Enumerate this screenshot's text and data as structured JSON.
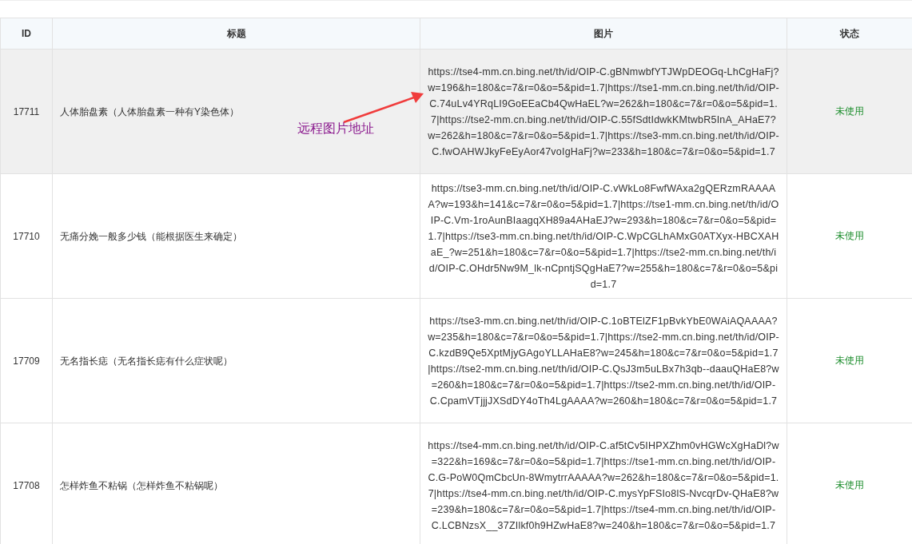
{
  "table": {
    "columns": [
      {
        "label": "ID"
      },
      {
        "label": "标题"
      },
      {
        "label": "图片"
      },
      {
        "label": "状态"
      }
    ],
    "rows": [
      {
        "id": "17711",
        "title": "人体胎盘素（人体胎盘素一种有Y染色体）",
        "image": "https://tse4-mm.cn.bing.net/th/id/OIP-C.gBNmwbfYTJWpDEOGq-LhCgHaFj?w=196&h=180&c=7&r=0&o=5&pid=1.7|https://tse1-mm.cn.bing.net/th/id/OIP-C.74uLv4YRqLI9GoEEaCb4QwHaEL?w=262&h=180&c=7&r=0&o=5&pid=1.7|https://tse2-mm.cn.bing.net/th/id/OIP-C.55fSdtIdwkKMtwbR5InA_AHaE7?w=262&h=180&c=7&r=0&o=5&pid=1.7|https://tse3-mm.cn.bing.net/th/id/OIP-C.fwOAHWJkyFeEyAor47voIgHaFj?w=233&h=180&c=7&r=0&o=5&pid=1.7",
        "status": "未使用",
        "highlighted": true
      },
      {
        "id": "17710",
        "title": "无痛分娩一般多少钱（能根据医生来确定）",
        "image": "https://tse3-mm.cn.bing.net/th/id/OIP-C.vWkLo8FwfWAxa2gQERzmRAAAAA?w=193&h=141&c=7&r=0&o=5&pid=1.7|https://tse1-mm.cn.bing.net/th/id/OIP-C.Vm-1roAunBIaagqXH89a4AHaEJ?w=293&h=180&c=7&r=0&o=5&pid=1.7|https://tse3-mm.cn.bing.net/th/id/OIP-C.WpCGLhAMxG0ATXyx-HBCXAHaE_?w=251&h=180&c=7&r=0&o=5&pid=1.7|https://tse2-mm.cn.bing.net/th/id/OIP-C.OHdr5Nw9M_lk-nCpntjSQgHaE7?w=255&h=180&c=7&r=0&o=5&pid=1.7",
        "status": "未使用",
        "highlighted": false
      },
      {
        "id": "17709",
        "title": "无名指长痣（无名指长痣有什么症状呢）",
        "image": "https://tse3-mm.cn.bing.net/th/id/OIP-C.1oBTElZF1pBvkYbE0WAiAQAAAA?w=235&h=180&c=7&r=0&o=5&pid=1.7|https://tse2-mm.cn.bing.net/th/id/OIP-C.kzdB9Qe5XptMjyGAgoYLLAHaE8?w=245&h=180&c=7&r=0&o=5&pid=1.7|https://tse2-mm.cn.bing.net/th/id/OIP-C.QsJ3m5uLBx7h3qb--daauQHaE8?w=260&h=180&c=7&r=0&o=5&pid=1.7|https://tse2-mm.cn.bing.net/th/id/OIP-C.CpamVTjjjJXSdDY4oTh4LgAAAA?w=260&h=180&c=7&r=0&o=5&pid=1.7",
        "status": "未使用",
        "highlighted": false
      },
      {
        "id": "17708",
        "title": "怎样炸鱼不粘锅（怎样炸鱼不粘锅呢）",
        "image": "https://tse4-mm.cn.bing.net/th/id/OIP-C.af5tCv5IHPXZhm0vHGWcXgHaDl?w=322&h=169&c=7&r=0&o=5&pid=1.7|https://tse1-mm.cn.bing.net/th/id/OIP-C.G-PoW0QmCbcUn-8WmytrrAAAAA?w=262&h=180&c=7&r=0&o=5&pid=1.7|https://tse4-mm.cn.bing.net/th/id/OIP-C.mysYpFSIo8lS-NvcqrDv-QHaE8?w=239&h=180&c=7&r=0&o=5&pid=1.7|https://tse4-mm.cn.bing.net/th/id/OIP-C.LCBNzsX__37ZIlkf0h9HZwHaE8?w=240&h=180&c=7&r=0&o=5&pid=1.7",
        "status": "未使用",
        "highlighted": false
      }
    ]
  },
  "annotation": {
    "label": "远程图片地址"
  }
}
